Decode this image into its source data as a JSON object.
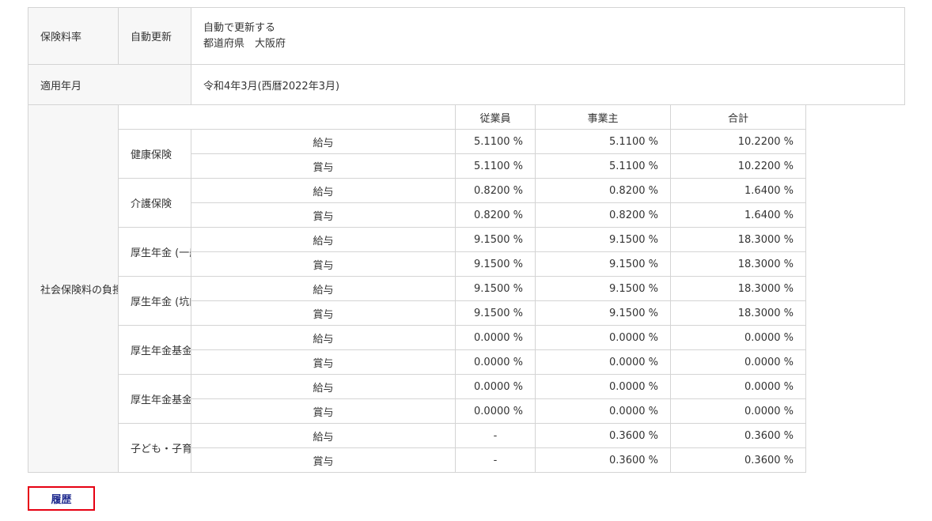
{
  "header": {
    "label": "保険料率",
    "auto_update_label": "自動更新",
    "auto_update_value": "自動で更新する",
    "prefecture": "都道府県　大阪府"
  },
  "applicable": {
    "label": "適用年月",
    "value": "令和4年3月(西暦2022年3月)"
  },
  "rates": {
    "label": "社会保険料の負担 (掛金) 率",
    "columns": [
      "従業員",
      "事業主",
      "合計"
    ],
    "rows": [
      {
        "name": "健康保険",
        "items": [
          {
            "type": "給与",
            "employee": "5.1100 %",
            "employer": "5.1100 %",
            "total": "10.2200 %"
          },
          {
            "type": "賞与",
            "employee": "5.1100 %",
            "employer": "5.1100 %",
            "total": "10.2200 %"
          }
        ]
      },
      {
        "name": "介護保険",
        "items": [
          {
            "type": "給与",
            "employee": "0.8200 %",
            "employer": "0.8200 %",
            "total": "1.6400 %"
          },
          {
            "type": "賞与",
            "employee": "0.8200 %",
            "employer": "0.8200 %",
            "total": "1.6400 %"
          }
        ]
      },
      {
        "name": "厚生年金 (一般)",
        "items": [
          {
            "type": "給与",
            "employee": "9.1500 %",
            "employer": "9.1500 %",
            "total": "18.3000 %"
          },
          {
            "type": "賞与",
            "employee": "9.1500 %",
            "employer": "9.1500 %",
            "total": "18.3000 %"
          }
        ]
      },
      {
        "name": "厚生年金 (坑内員)",
        "items": [
          {
            "type": "給与",
            "employee": "9.1500 %",
            "employer": "9.1500 %",
            "total": "18.3000 %"
          },
          {
            "type": "賞与",
            "employee": "9.1500 %",
            "employer": "9.1500 %",
            "total": "18.3000 %"
          }
        ]
      },
      {
        "name": "厚生年金基金 (一般)",
        "items": [
          {
            "type": "給与",
            "employee": "0.0000 %",
            "employer": "0.0000 %",
            "total": "0.0000 %"
          },
          {
            "type": "賞与",
            "employee": "0.0000 %",
            "employer": "0.0000 %",
            "total": "0.0000 %"
          }
        ]
      },
      {
        "name": "厚生年金基金 (坑内員)",
        "items": [
          {
            "type": "給与",
            "employee": "0.0000 %",
            "employer": "0.0000 %",
            "total": "0.0000 %"
          },
          {
            "type": "賞与",
            "employee": "0.0000 %",
            "employer": "0.0000 %",
            "total": "0.0000 %"
          }
        ]
      },
      {
        "name": "子ども・子育て拠出金",
        "items": [
          {
            "type": "給与",
            "employee": "-",
            "employer": "0.3600 %",
            "total": "0.3600 %"
          },
          {
            "type": "賞与",
            "employee": "-",
            "employer": "0.3600 %",
            "total": "0.3600 %"
          }
        ]
      }
    ]
  },
  "actions": {
    "history_label": "履歴"
  },
  "colors": {
    "border": "#d4d4d4",
    "button_border": "#e60012",
    "button_text": "#1f2b8f"
  }
}
